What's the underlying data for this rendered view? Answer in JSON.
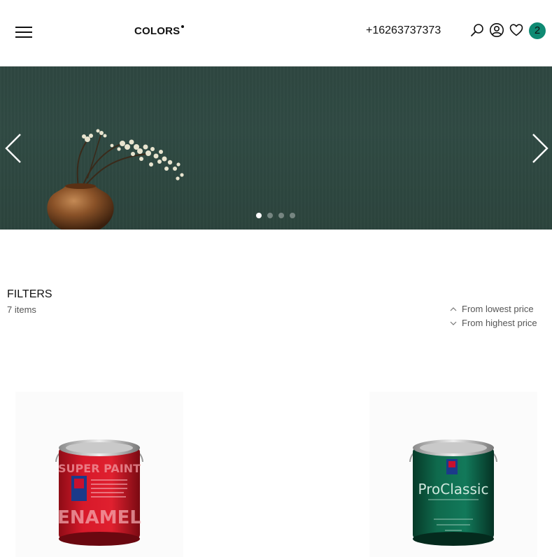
{
  "header": {
    "menu_icon": "hamburger-menu-icon",
    "logo_text": "COLORS",
    "phone": "+16263737373",
    "icons": [
      "search-icon",
      "user-account-icon",
      "heart-icon"
    ],
    "cart_count": "2",
    "accent_color": "#0f8a73"
  },
  "hero": {
    "slides_count": 4,
    "active_slide": 1,
    "prev_icon": "chevron-left-icon",
    "next_icon": "chevron-right-icon",
    "background_color": "#2f4741"
  },
  "filters": {
    "title": "FILTERS",
    "items_count": "7 items",
    "sort_options": [
      {
        "label": "From lowest price",
        "icon": "chevron-up-icon"
      },
      {
        "label": "From highest price",
        "icon": "chevron-down-icon"
      }
    ]
  },
  "products": [
    {
      "image": "red-paint-can",
      "can_color": "#d7192a",
      "brand": "SUPER PAINT",
      "name": "ENAMEL"
    },
    {
      "image": "green-paint-can",
      "can_color": "#0f6a4d",
      "brand": "ProClassic"
    }
  ]
}
